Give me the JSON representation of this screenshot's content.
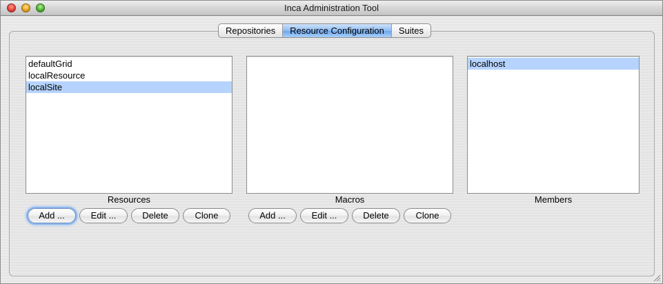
{
  "window": {
    "title": "Inca Administration Tool"
  },
  "tabs": [
    {
      "label": "Repositories",
      "selected": false
    },
    {
      "label": "Resource Configuration",
      "selected": true
    },
    {
      "label": "Suites",
      "selected": false
    }
  ],
  "resources": {
    "label": "Resources",
    "items": [
      "defaultGrid",
      "localResource",
      "localSite"
    ],
    "selected_item": "localSite",
    "buttons": {
      "add": "Add ...",
      "edit": "Edit ...",
      "delete": "Delete",
      "clone": "Clone"
    }
  },
  "macros": {
    "label": "Macros",
    "items": [],
    "buttons": {
      "add": "Add ...",
      "edit": "Edit ...",
      "delete": "Delete",
      "clone": "Clone"
    }
  },
  "members": {
    "label": "Members",
    "items": [
      "localhost"
    ],
    "selected_item": "localhost"
  },
  "colors": {
    "selection": "#b5d3fc",
    "selected_tab": "#8fbcf1"
  }
}
